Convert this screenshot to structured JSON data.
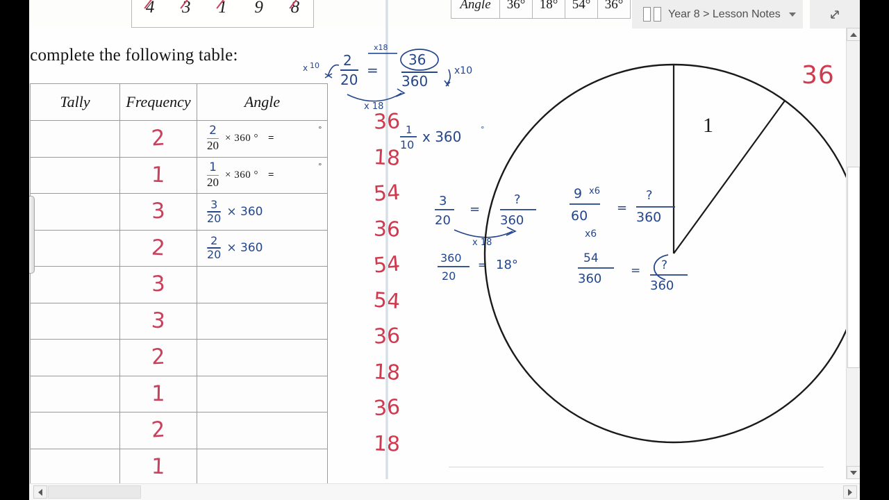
{
  "toolbar": {
    "notebook_label": "Year 8 > Lesson Notes",
    "book_icon": "notebook-icon",
    "chevron_icon": "chevron-down-icon",
    "expand_icon": "expand-diagonal-icon"
  },
  "angle_strip": {
    "header": "Angle",
    "values": [
      "36°",
      "18°",
      "54°",
      "36°"
    ]
  },
  "top_strip": {
    "crossed_numbers": [
      "4",
      "3",
      "1",
      "9",
      "8"
    ]
  },
  "prompt": "o complete the following table:",
  "table": {
    "headers": [
      "Tally",
      "Frequency",
      "Angle"
    ],
    "rows": [
      {
        "frequency": "2",
        "angle_kind": "printed",
        "num": "2",
        "den": "20",
        "x360": "× 360 °",
        "eq": "=",
        "deg": "°"
      },
      {
        "frequency": "1",
        "angle_kind": "printed",
        "num": "1",
        "den": "20",
        "x360": "× 360 °",
        "eq": "=",
        "deg": "°"
      },
      {
        "frequency": "3",
        "angle_kind": "hand",
        "num": "3",
        "den": "20",
        "x360": "× 360"
      },
      {
        "frequency": "2",
        "angle_kind": "hand",
        "num": "2",
        "den": "20",
        "x360": "× 360"
      },
      {
        "frequency": "3",
        "angle_kind": "empty"
      },
      {
        "frequency": "3",
        "angle_kind": "empty"
      },
      {
        "frequency": "2",
        "angle_kind": "empty"
      },
      {
        "frequency": "1",
        "angle_kind": "empty"
      },
      {
        "frequency": "2",
        "angle_kind": "empty"
      },
      {
        "frequency": "1",
        "angle_kind": "empty"
      }
    ]
  },
  "answers": [
    "36",
    "18",
    "54",
    "36",
    "54",
    "54",
    "36",
    "18",
    "36",
    "18"
  ],
  "annotations": {
    "work1": {
      "x10_left": "x 10",
      "frac_left_num": "2",
      "frac_left_den": "20",
      "equals": "=",
      "frac_right_num": "36",
      "frac_right_den": "360",
      "x10_right": "x10",
      "x18_below": "x 18",
      "x18_above": "x18"
    },
    "work2": {
      "frac_num": "1",
      "frac_den": "10",
      "expr": "x 360"
    },
    "work3": {
      "frac_left_num": "3",
      "frac_left_den": "20",
      "equals": "=",
      "frac_right_num": "?",
      "frac_right_den": "360",
      "x18": "x 18",
      "line2_num": "360",
      "line2_den": "20",
      "line2_eq": "=",
      "line2_ans": "18°"
    },
    "work4": {
      "frac_left_num": "9",
      "frac_left_den": "60",
      "x6_top": "x6",
      "x6_bottom": "x6",
      "equals": "=",
      "frac_right_num": "?",
      "frac_right_den": "360",
      "line2_num": "54",
      "line2_den": "360",
      "line2_eq": "=",
      "line2_num2": "?",
      "line2_den2": "360"
    },
    "red_360": "36",
    "circle_sector_label": "1"
  },
  "colors": {
    "red_ink": "#c9415c",
    "blue_ink": "#24468c",
    "page": "#fefefe",
    "chip": "#eeeeee"
  },
  "scrollbars": {
    "v_up": "scroll-up-arrow",
    "v_down": "scroll-down-arrow",
    "h_left": "scroll-left-arrow",
    "h_right": "scroll-right-arrow"
  }
}
